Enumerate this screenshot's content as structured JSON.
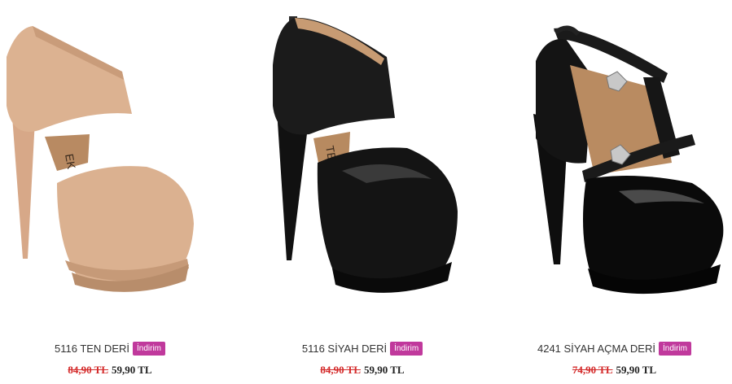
{
  "products": [
    {
      "name": "5116 TEN DERİ",
      "badge": "İndirim",
      "old_price": "84,90 TL",
      "new_price": "59,90 TL",
      "color": "#d9b08e",
      "image": "nude-platform-ankle-cuff-heel"
    },
    {
      "name": "5116 SİYAH DERİ",
      "badge": "İndirim",
      "old_price": "84,90 TL",
      "new_price": "59,90 TL",
      "color": "#151515",
      "image": "black-platform-ankle-cuff-heel"
    },
    {
      "name": "4241 SİYAH AÇMA DERİ",
      "badge": "İndirim",
      "old_price": "74,90 TL",
      "new_price": "59,90 TL",
      "color": "#0c0c0c",
      "image": "black-patent-t-strap-buckle-heel"
    }
  ]
}
